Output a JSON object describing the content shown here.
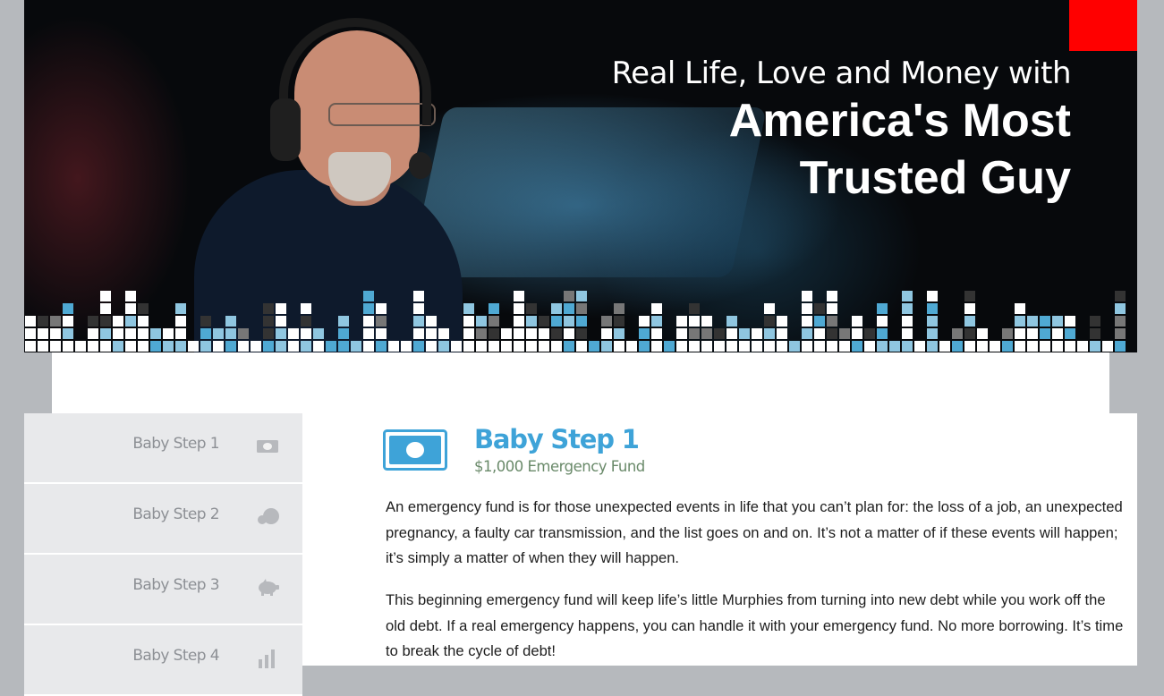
{
  "hero": {
    "line1": "Real Life, Love and Money with",
    "line2a": "America's Most",
    "line2b": "Trusted Guy"
  },
  "sidebar": {
    "items": [
      {
        "label": "Baby Step 1",
        "icon": "money-icon"
      },
      {
        "label": "Baby Step 2",
        "icon": "snowball-icon"
      },
      {
        "label": "Baby Step 3",
        "icon": "piggy-bank-icon"
      },
      {
        "label": "Baby Step 4",
        "icon": "bar-chart-icon"
      }
    ]
  },
  "main": {
    "title": "Baby Step 1",
    "subtitle": "$1,000 Emergency Fund",
    "paragraphs": [
      "An emergency fund is for those unexpected events in life that you can’t plan for: the loss of a job, an unexpected pregnancy, a faulty car transmission, and the list goes on and on. It’s not a matter of if these events will happen; it’s simply a matter of when they will happen.",
      "This beginning emergency fund will keep life’s little Murphies from turning into new debt while you work off the old debt. If a real emergency happens, you can handle it with your emergency fund. No more borrowing. It’s time to break the cycle of debt!"
    ]
  },
  "colors": {
    "accent_blue": "#3ea3d8",
    "subtitle_green": "#6a8a6a",
    "red_square": "#ff0000",
    "sidebar_bg": "#e8e9eb",
    "page_bg": "#b6b9bd"
  }
}
